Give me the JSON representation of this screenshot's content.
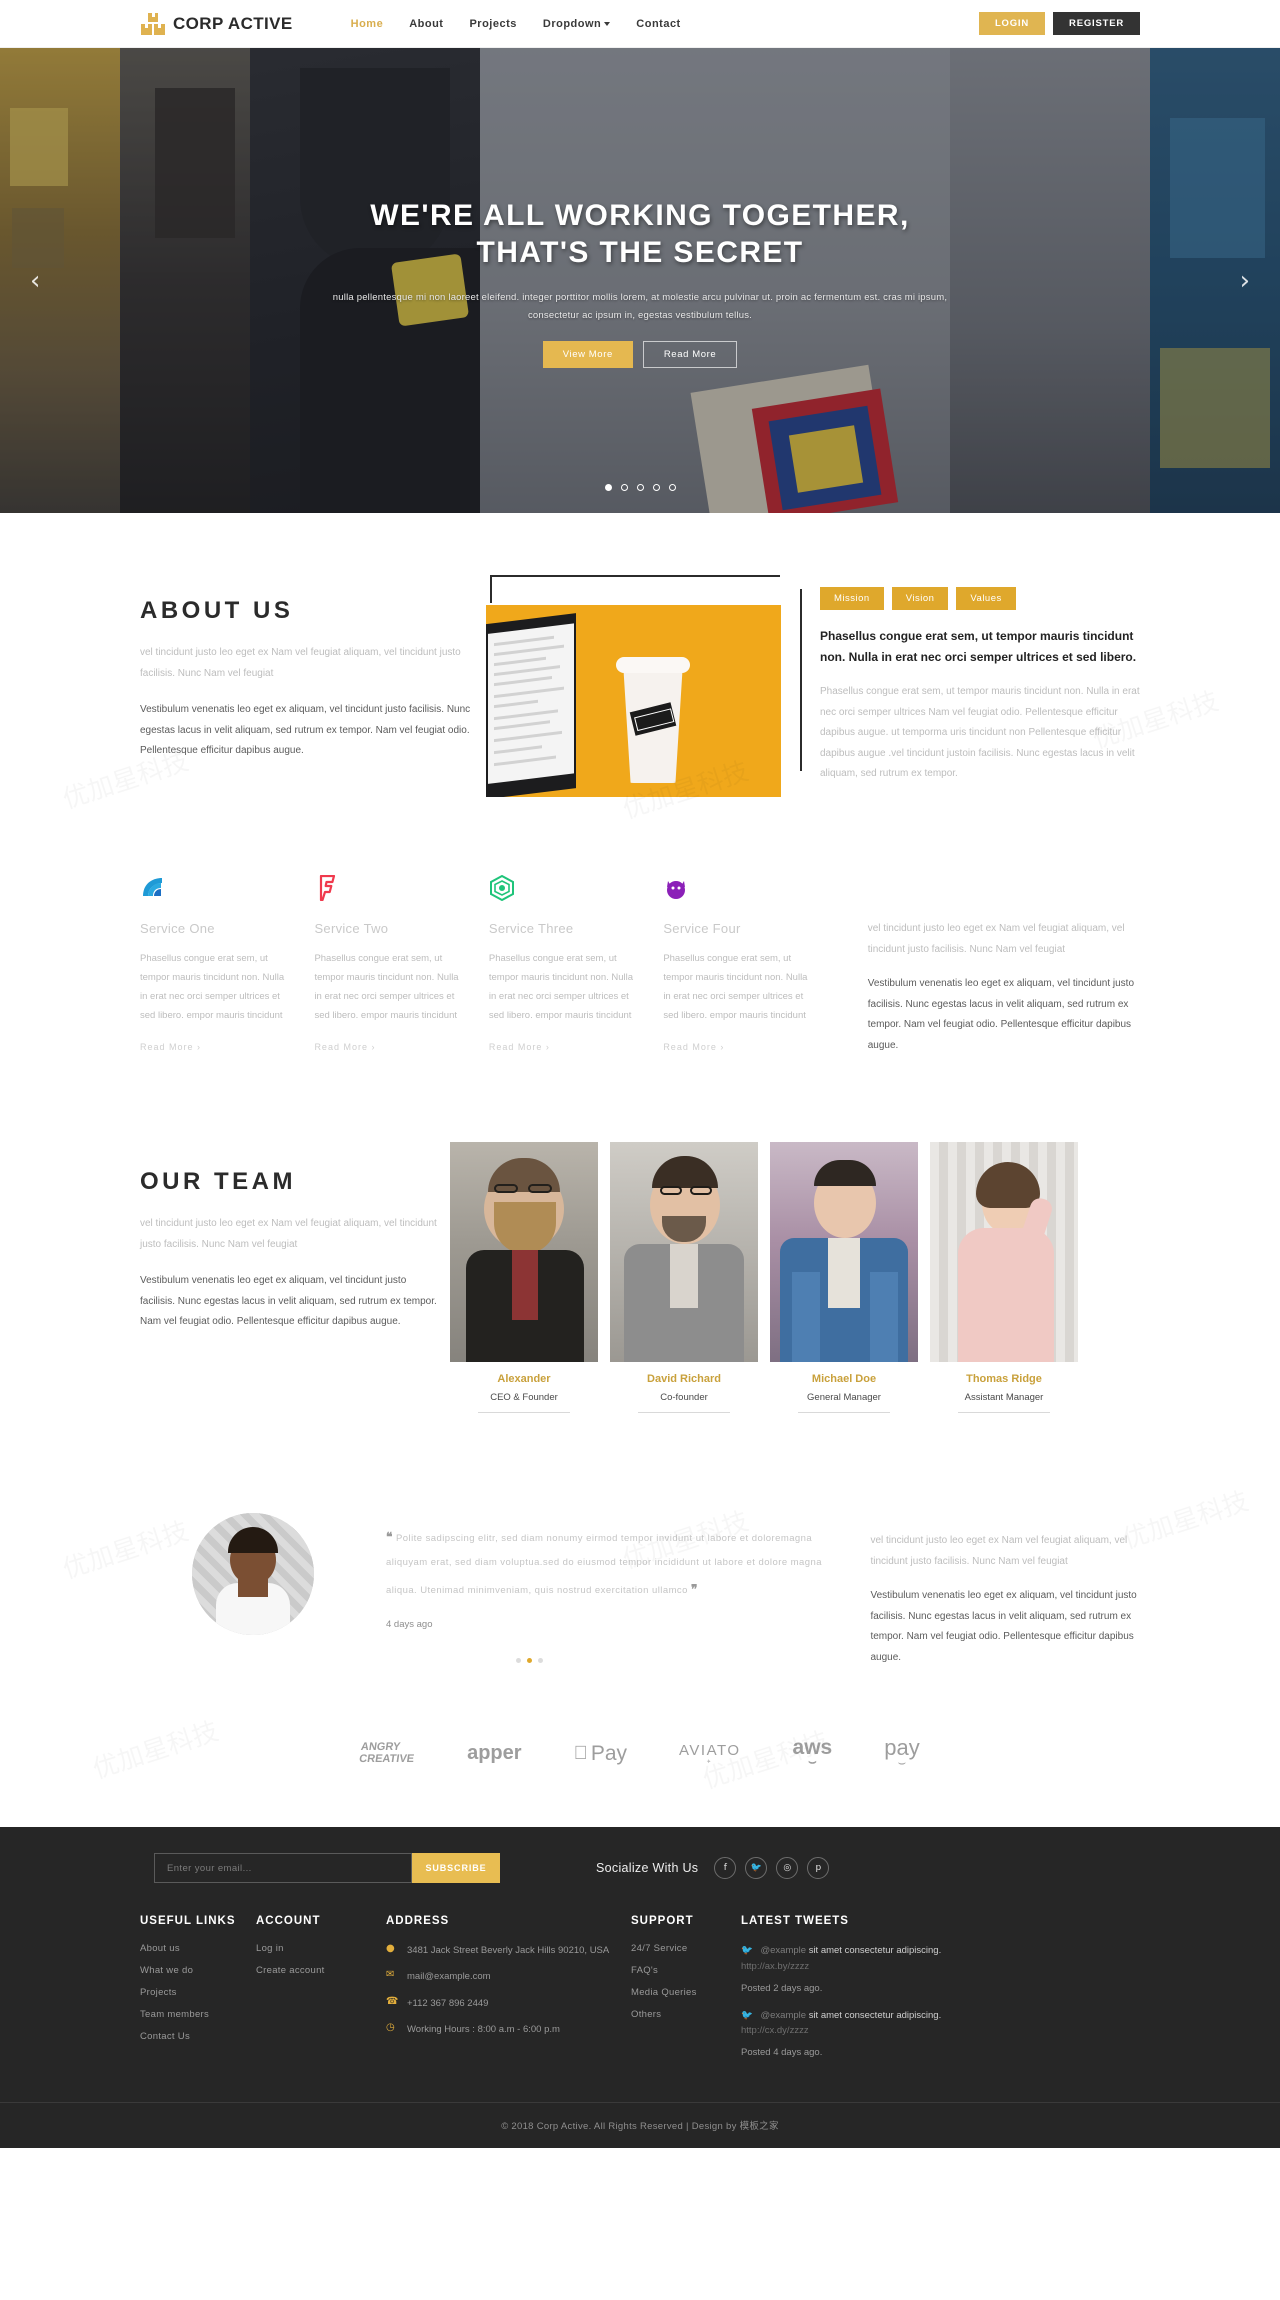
{
  "header": {
    "brand": "CORP ACTIVE",
    "nav": [
      {
        "label": "Home",
        "active": true
      },
      {
        "label": "About",
        "active": false
      },
      {
        "label": "Projects",
        "active": false
      },
      {
        "label": "Dropdown",
        "active": false,
        "caret": true
      },
      {
        "label": "Contact",
        "active": false
      }
    ],
    "login_label": "LOGIN",
    "register_label": "REGISTER",
    "accent": "#dfb250"
  },
  "hero": {
    "title_line1": "WE'RE ALL WORKING TOGETHER,",
    "title_line2": "THAT'S THE SECRET",
    "subtitle": "nulla pellentesque mi non laoreet eleifend. integer porttitor mollis lorem, at molestie arcu pulvinar ut. proin ac fermentum est. cras mi ipsum, consectetur ac ipsum in, egestas vestibulum tellus.",
    "btn_primary": "View More",
    "btn_secondary": "Read More",
    "prev_icon": "chevron-left-icon",
    "next_icon": "chevron-right-icon",
    "dots": 5,
    "active_dot": 0
  },
  "about": {
    "title": "ABOUT US",
    "paragraph_light": "vel tincidunt justo leo eget ex Nam vel feugiat aliquam, vel tincidunt justo facilisis. Nunc Nam vel feugiat",
    "paragraph_dark": "Vestibulum venenatis leo eget ex aliquam, vel tincidunt justo facilisis. Nunc egestas lacus in velit aliquam, sed rutrum ex tempor. Nam vel feugiat odio. Pellentesque efficitur dapibus augue.",
    "tabs": [
      "Mission",
      "Vision",
      "Values"
    ],
    "lead": "Phasellus congue erat sem, ut tempor mauris tincidunt non. Nulla in erat nec orci semper ultrices et sed libero.",
    "body": "Phasellus congue erat sem, ut tempor mauris tincidunt non. Nulla in erat nec orci semper ultrices Nam vel feugiat odio. Pellentesque efficitur dapibus augue. ut temporma uris tincidunt non Pellentesque efficitur dapibus augue .vel tincidunt justoin facilisis. Nunc egestas lacus in velit aliquam, sed rutrum ex tempor."
  },
  "services": {
    "items": [
      {
        "title": "Service One",
        "icon": "wifi-signal-icon",
        "color": "#1b8ad6",
        "text": "Phasellus congue erat sem, ut tempor mauris tincidunt non. Nulla in erat nec orci semper ultrices et sed libero. empor mauris tincidunt",
        "more": "Read More ›"
      },
      {
        "title": "Service Two",
        "icon": "foursquare-icon",
        "color": "#f0394d",
        "text": "Phasellus congue erat sem, ut tempor mauris tincidunt non. Nulla in erat nec orci semper ultrices et sed libero. empor mauris tincidunt",
        "more": "Read More ›"
      },
      {
        "title": "Service Three",
        "icon": "hexagon-node-icon",
        "color": "#1fc47a",
        "text": "Phasellus congue erat sem, ut tempor mauris tincidunt non. Nulla in erat nec orci semper ultrices et sed libero. empor mauris tincidunt",
        "more": "Read More ›"
      },
      {
        "title": "Service Four",
        "icon": "bug-creature-icon",
        "color": "#8b20b8",
        "text": "Phasellus congue erat sem, ut tempor mauris tincidunt non. Nulla in erat nec orci semper ultrices et sed libero. empor mauris tincidunt",
        "more": "Read More ›"
      }
    ],
    "side_light": "vel tincidunt justo leo eget ex Nam vel feugiat aliquam, vel tincidunt justo facilisis. Nunc Nam vel feugiat",
    "side_dark": "Vestibulum venenatis leo eget ex aliquam, vel tincidunt justo facilisis. Nunc egestas lacus in velit aliquam, sed rutrum ex tempor. Nam vel feugiat odio. Pellentesque efficitur dapibus augue."
  },
  "team": {
    "title": "OUR TEAM",
    "paragraph_light": "vel tincidunt justo leo eget ex Nam vel feugiat aliquam, vel tincidunt justo facilisis. Nunc Nam vel feugiat",
    "paragraph_dark": "Vestibulum venenatis leo eget ex aliquam, vel tincidunt justo facilisis. Nunc egestas lacus in velit aliquam, sed rutrum ex tempor. Nam vel feugiat odio. Pellentesque efficitur dapibus augue.",
    "members": [
      {
        "name": "Alexander",
        "role": "CEO & Founder"
      },
      {
        "name": "David Richard",
        "role": "Co-founder"
      },
      {
        "name": "Michael Doe",
        "role": "General Manager"
      },
      {
        "name": "Thomas Ridge",
        "role": "Assistant Manager"
      }
    ],
    "name_color": "#c9a13c"
  },
  "testimonial": {
    "quote": "Polite sadipscing elitr, sed diam nonumy eirmod tempor invidunt ut labore et doloremagna aliquyam erat, sed diam voluptua.sed do eiusmod tempor incididunt ut labore et dolore magna aliqua. Utenimad minimveniam, quis nostrud exercitation ullamco",
    "ago": "4 days ago",
    "dots": 3,
    "active_dot": 1,
    "side_light": "vel tincidunt justo leo eget ex Nam vel feugiat aliquam, vel tincidunt justo facilisis. Nunc Nam vel feugiat",
    "side_dark": "Vestibulum venenatis leo eget ex aliquam, vel tincidunt justo facilisis. Nunc egestas lacus in velit aliquam, sed rutrum ex tempor. Nam vel feugiat odio. Pellentesque efficitur dapibus augue."
  },
  "brands": [
    {
      "name": "ANGRY CREATIVE",
      "icon": "angry-creative-logo"
    },
    {
      "name": "apper",
      "icon": "apper-logo"
    },
    {
      "name": "Pay",
      "icon": "apple-pay-logo"
    },
    {
      "name": "AVIATO",
      "icon": "aviato-logo"
    },
    {
      "name": "aws",
      "icon": "aws-logo"
    },
    {
      "name": "pay",
      "icon": "amazon-pay-logo"
    }
  ],
  "footer": {
    "subscribe_placeholder": "Enter your email...",
    "subscribe_value": "",
    "subscribe_label": "SUBSCRIBE",
    "socialize_label": "Socialize With Us",
    "socials": [
      {
        "name": "facebook-icon",
        "glyph": "f"
      },
      {
        "name": "twitter-icon",
        "glyph": "ᴠ"
      },
      {
        "name": "instagram-icon",
        "glyph": "◎"
      },
      {
        "name": "pinterest-icon",
        "glyph": "p"
      }
    ],
    "useful_links": {
      "title": "USEFUL LINKS",
      "items": [
        "About us",
        "What we do",
        "Projects",
        "Team members",
        "Contact Us"
      ]
    },
    "account": {
      "title": "ACCOUNT",
      "items": [
        "Log in",
        "Create account"
      ]
    },
    "address": {
      "title": "ADDRESS",
      "rows": [
        {
          "icon": "map-pin-icon",
          "glyph": "●",
          "text": "3481 Jack Street Beverly Jack Hills 90210, USA"
        },
        {
          "icon": "envelope-icon",
          "glyph": "✉",
          "text": "mail@example.com"
        },
        {
          "icon": "phone-icon",
          "glyph": "☎",
          "text": "+112 367 896 2449"
        },
        {
          "icon": "clock-icon",
          "glyph": "◔",
          "text": "Working Hours : 8:00 a.m - 6:00 p.m"
        }
      ]
    },
    "support": {
      "title": "SUPPORT",
      "items": [
        "24/7 Service",
        "FAQ's",
        "Media Queries",
        "Others"
      ]
    },
    "tweets": {
      "title": "LATEST TWEETS",
      "items": [
        {
          "handle": "@example",
          "text": "sit amet consectetur adipiscing.",
          "url": "http://ax.by/zzzz",
          "posted": "Posted 2 days ago."
        },
        {
          "handle": "@example",
          "text": "sit amet consectetur adipiscing.",
          "url": "http://cx.dy/zzzz",
          "posted": "Posted 4 days ago."
        }
      ]
    },
    "copyright": "© 2018 Corp Active. All Rights Reserved | Design by 模板之家"
  }
}
